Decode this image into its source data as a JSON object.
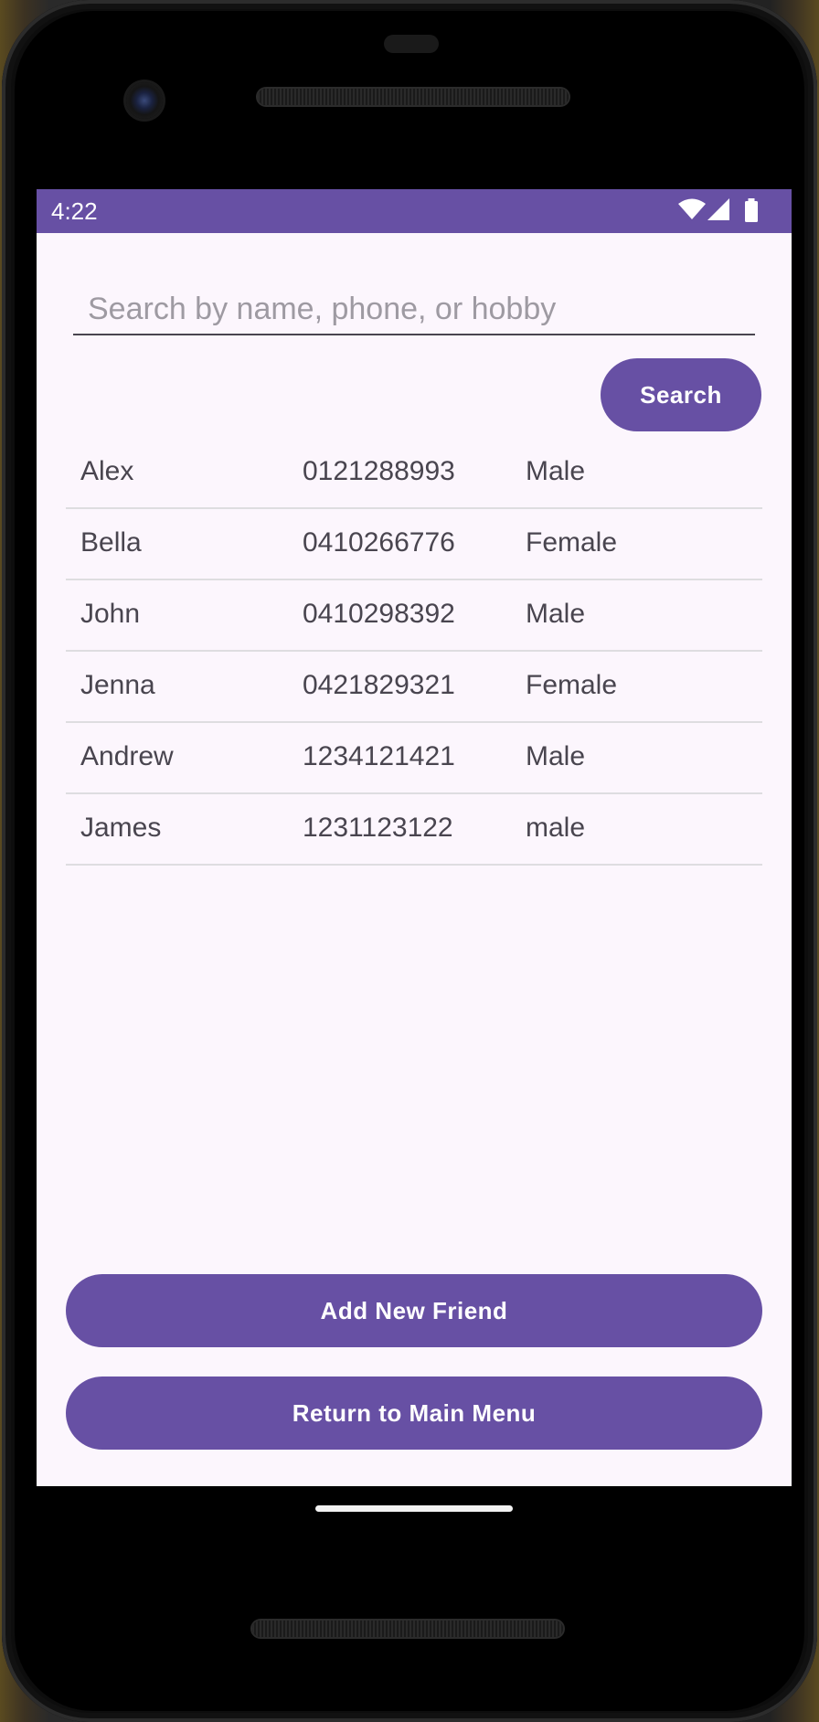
{
  "status_bar": {
    "time": "4:22",
    "icons": [
      "wifi-icon",
      "cellular-signal-icon",
      "battery-icon"
    ],
    "color": "#6750a4"
  },
  "search": {
    "placeholder": "Search by name, phone, or hobby",
    "value": "",
    "button_label": "Search"
  },
  "friends": [
    {
      "name": "Alex",
      "phone": "0121288993",
      "gender": "Male"
    },
    {
      "name": "Bella",
      "phone": "0410266776",
      "gender": "Female"
    },
    {
      "name": "John",
      "phone": "0410298392",
      "gender": "Male"
    },
    {
      "name": "Jenna",
      "phone": "0421829321",
      "gender": "Female"
    },
    {
      "name": "Andrew",
      "phone": "1234121421",
      "gender": "Male"
    },
    {
      "name": "James",
      "phone": "1231123122",
      "gender": "male"
    }
  ],
  "actions": {
    "add_label": "Add New Friend",
    "return_label": "Return to Main Menu"
  },
  "colors": {
    "primary": "#6750a4",
    "background": "#fcf6fd",
    "row_text": "#49454f",
    "divider": "#dedde0"
  }
}
